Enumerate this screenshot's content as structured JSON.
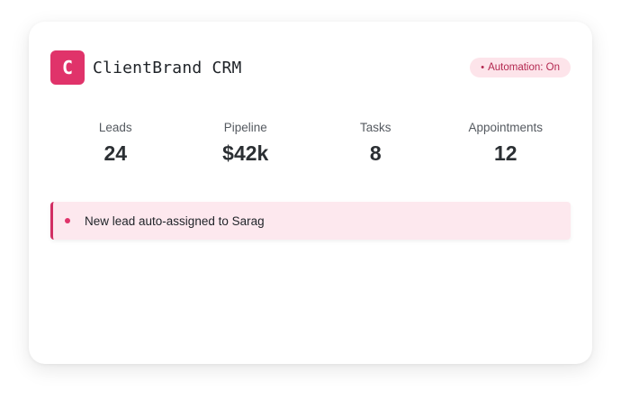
{
  "colors": {
    "accent": "#e0336a",
    "badge_bg": "#fde4ea",
    "badge_text": "#b3274f",
    "notice_bg": "#fde8ee",
    "notice_border": "#d22e63"
  },
  "header": {
    "logo_letter": "C",
    "title": "ClientBrand CRM",
    "badge": {
      "dot": "•",
      "label": "Automation: On"
    }
  },
  "stats": [
    {
      "label": "Leads",
      "value": "24"
    },
    {
      "label": "Pipeline",
      "value": "$42k"
    },
    {
      "label": "Tasks",
      "value": "8"
    },
    {
      "label": "Appointments",
      "value": "12"
    }
  ],
  "notifications": [
    {
      "text": "New lead auto-assigned to Sarag"
    }
  ]
}
